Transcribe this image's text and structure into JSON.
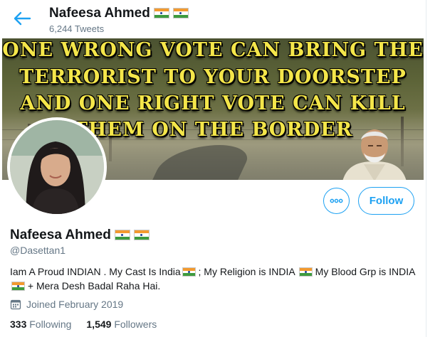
{
  "header": {
    "back_icon": "arrow-left-icon",
    "name": "Nafeesa Ahmed",
    "tweets_count": "6,244 Tweets"
  },
  "banner": {
    "lines": [
      "One wrong vote can bring the",
      "terrorist to your doorstep",
      "and one right vote can kill",
      "them on the border"
    ]
  },
  "actions": {
    "more_icon": "more-horizontal-icon",
    "follow_label": "Follow"
  },
  "profile": {
    "name": "Nafeesa Ahmed",
    "handle": "@Dasettan1",
    "bio": {
      "part1": "Iam  A Proud INDIAN . My Cast Is India",
      "part2": " ; My Religion is INDIA ",
      "part3": " My Blood Grp is INDIA ",
      "part4": " + Mera Desh Badal Raha Hai."
    },
    "joined": "Joined February 2019",
    "following_count": "333",
    "following_label": "Following",
    "followers_count": "1,549",
    "followers_label": "Followers"
  },
  "colors": {
    "accent": "#1da1f2",
    "text": "#14171a",
    "secondary_text": "#657786",
    "banner_text": "#f4e64a"
  }
}
